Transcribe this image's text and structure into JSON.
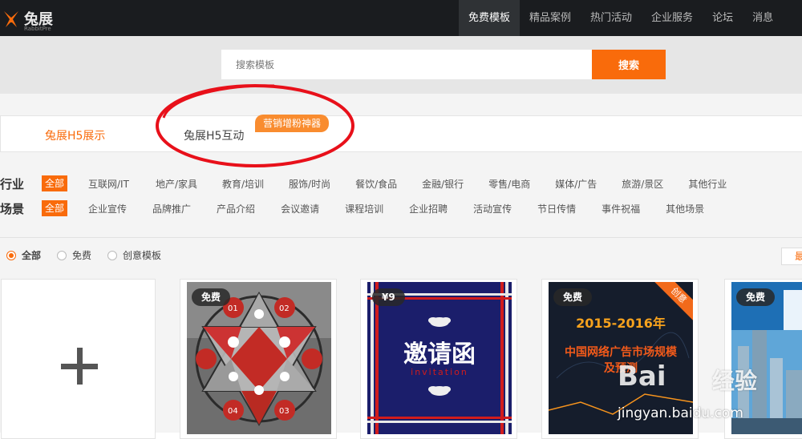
{
  "brand": {
    "name": "兔展",
    "sub": "RabbitPre"
  },
  "nav": {
    "items": [
      "免费模板",
      "精品案例",
      "热门活动",
      "企业服务",
      "论坛",
      "消息"
    ],
    "active_index": 0
  },
  "search": {
    "placeholder": "搜索模板",
    "button": "搜索"
  },
  "tabs": {
    "show": "兔展H5展示",
    "interact": "兔展H5互动",
    "badge": "营销增粉神器"
  },
  "filters": {
    "industry_label": "行业",
    "industry_all": "全部",
    "industry": [
      "互联网/IT",
      "地产/家具",
      "教育/培训",
      "服饰/时尚",
      "餐饮/食品",
      "金融/银行",
      "零售/电商",
      "媒体/广告",
      "旅游/景区",
      "其他行业"
    ],
    "scene_label": "场景",
    "scene_all": "全部",
    "scene": [
      "企业宣传",
      "品牌推广",
      "产品介绍",
      "会议邀请",
      "课程培训",
      "企业招聘",
      "活动宣传",
      "节日传情",
      "事件祝福",
      "其他场景"
    ]
  },
  "price_filter": {
    "options": [
      "全部",
      "免费",
      "创意模板"
    ],
    "selected_index": 0
  },
  "sort_button": "最",
  "cards": [
    {
      "tag": "免费",
      "hex_labels": [
        "01",
        "02",
        "03",
        "04"
      ]
    },
    {
      "tag": "¥9",
      "title": "邀请函",
      "subtitle": "invitation"
    },
    {
      "tag": "免费",
      "ribbon": "创意",
      "line1": "2015-2016年",
      "line2": "中国网络广告市场规模",
      "line3": "及预测"
    },
    {
      "tag": "免费"
    }
  ],
  "watermark": {
    "logo": "Bai",
    "logo2": "经验",
    "url": "jingyan.baidu.com"
  },
  "colors": {
    "accent": "#f96b0b",
    "nav_bg": "#1a1c1f",
    "annotation": "#e8101a"
  }
}
